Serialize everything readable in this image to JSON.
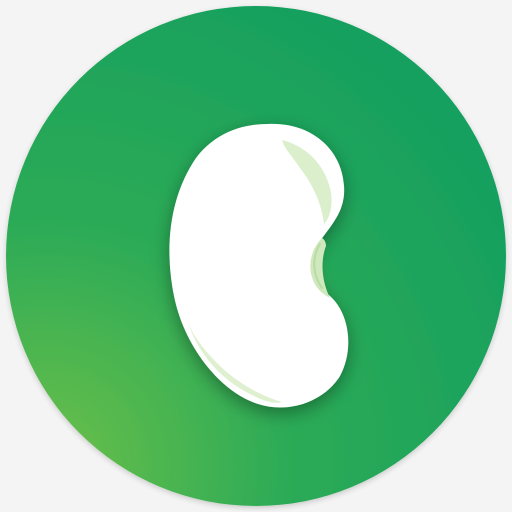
{
  "icon": {
    "name": "bean-icon",
    "colors": {
      "background": "#f4f4f4",
      "circle_light": "#6cc04a",
      "circle_mid": "#2dab56",
      "circle_dark": "#16a05e",
      "bean_fill": "#ffffff",
      "bean_highlight": "#d8edc8",
      "bean_highlight_edge": "#b9dca3"
    }
  }
}
